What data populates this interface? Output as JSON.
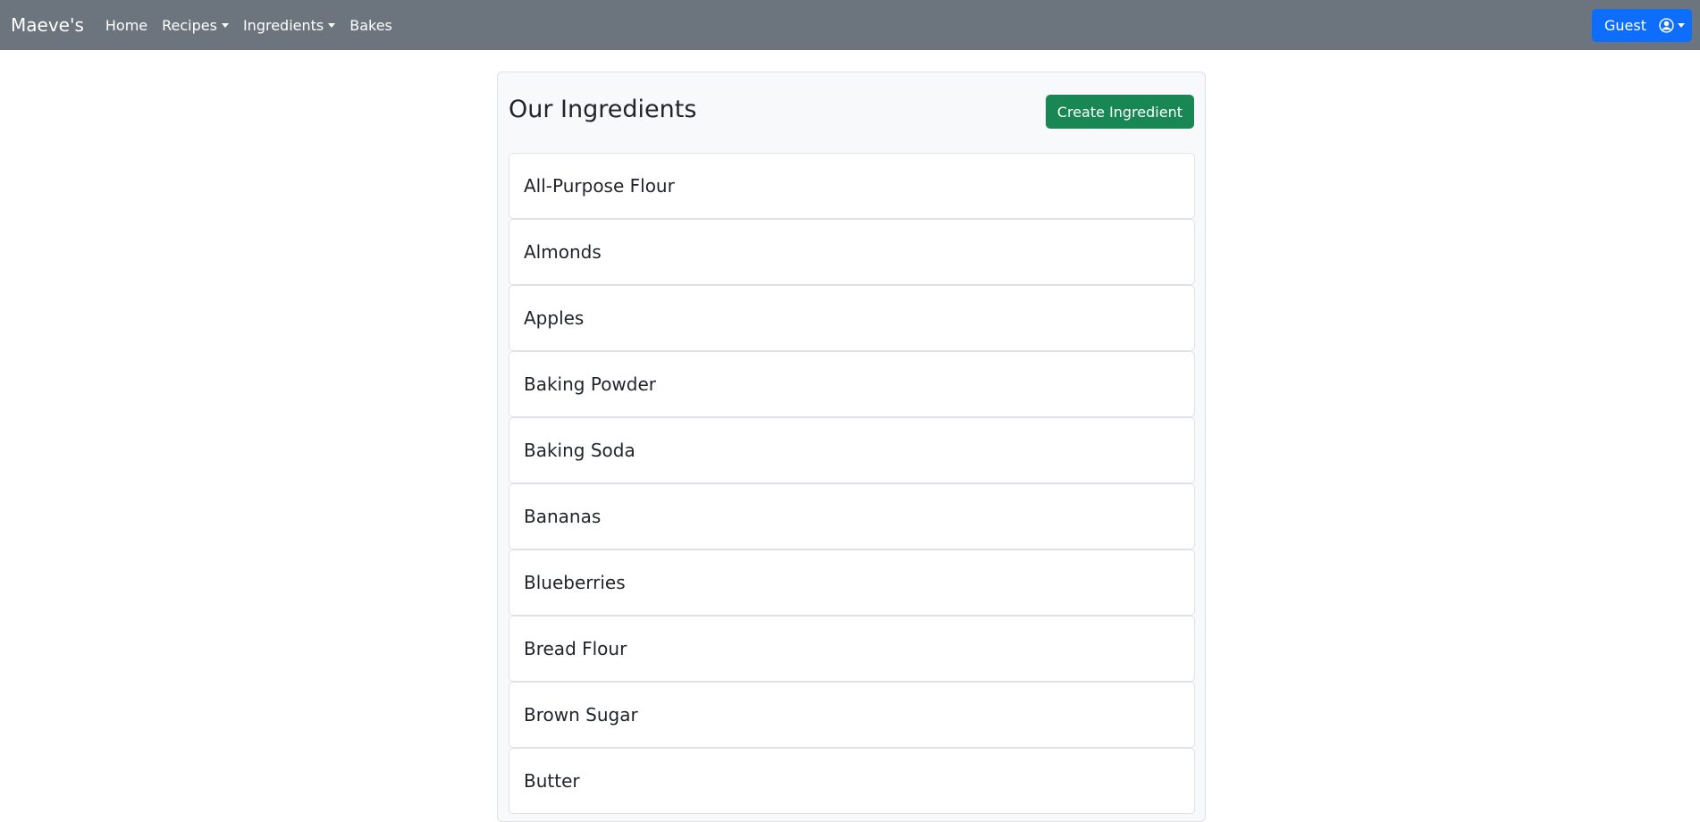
{
  "navbar": {
    "brand": "Maeve's",
    "links": [
      {
        "label": "Home",
        "dropdown": false
      },
      {
        "label": "Recipes",
        "dropdown": true
      },
      {
        "label": "Ingredients",
        "dropdown": true
      },
      {
        "label": "Bakes",
        "dropdown": false
      }
    ],
    "user": {
      "label": "Guest",
      "icon": "user-circle-icon"
    }
  },
  "main": {
    "title": "Our Ingredients",
    "create_label": "Create Ingredient",
    "ingredients": [
      "All-Purpose Flour",
      "Almonds",
      "Apples",
      "Baking Powder",
      "Baking Soda",
      "Bananas",
      "Blueberries",
      "Bread Flour",
      "Brown Sugar",
      "Butter"
    ]
  },
  "colors": {
    "navbar_bg": "#6c757d",
    "primary": "#0d6efd",
    "success": "#198754"
  }
}
